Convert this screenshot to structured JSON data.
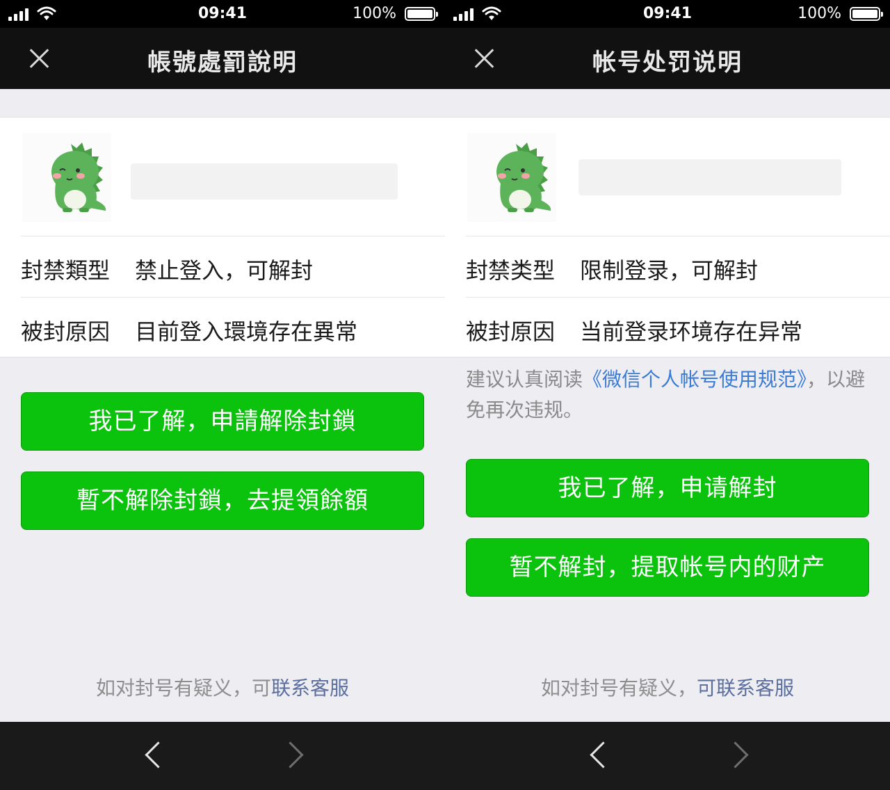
{
  "colors": {
    "primary_button": "#0bc20c",
    "link": "#3a7bd5",
    "footer_link": "#5a6f9e",
    "navbar": "#111111",
    "page_bg": "#ededf2"
  },
  "screens": [
    {
      "status": {
        "time": "09:41",
        "battery": "100%"
      },
      "nav": {
        "title": "帳號處罰說明",
        "close_icon": "close-icon"
      },
      "rows": [
        {
          "label": "封禁類型",
          "value": "禁止登入，可解封"
        },
        {
          "label": "被封原因",
          "value": "目前登入環境存在異常"
        }
      ],
      "buttons": {
        "primary": "我已了解，申請解除封鎖",
        "secondary": "暫不解除封鎖，去提領餘額"
      },
      "footer": {
        "text": "如对封号有疑义，可",
        "link": "联系客服"
      }
    },
    {
      "status": {
        "time": "09:41",
        "battery": "100%"
      },
      "nav": {
        "title": "帐号处罚说明",
        "close_icon": "close-icon"
      },
      "rows": [
        {
          "label": "封禁类型",
          "value": "限制登录，可解封"
        },
        {
          "label": "被封原因",
          "value": "当前登录环境存在异常"
        }
      ],
      "notice": {
        "prefix": "建议认真阅读",
        "link": "《微信个人帐号使用规范》",
        "suffix": "，以避免再次违规。"
      },
      "buttons": {
        "primary": "我已了解，申请解封",
        "secondary": "暂不解封，提取帐号内的财产"
      },
      "footer": {
        "text": "如对封号有疑义，",
        "link": "可联系客服"
      }
    }
  ]
}
